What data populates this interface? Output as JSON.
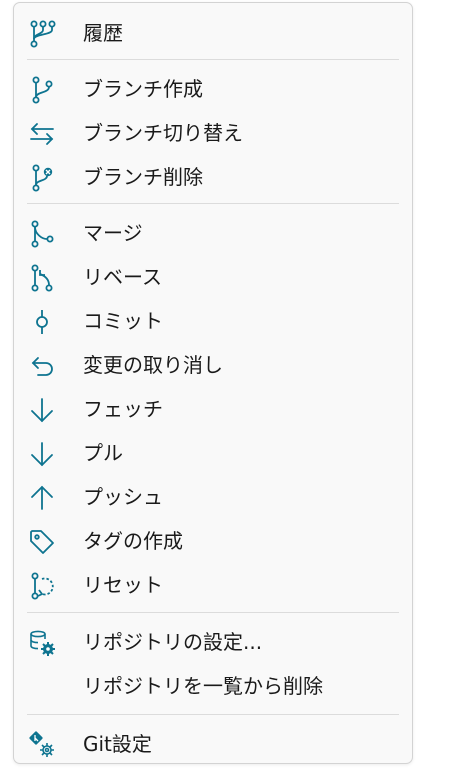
{
  "accent_color": "#0e7490",
  "menu": {
    "items": [
      {
        "label": "履歴",
        "icon": "history-branches-icon"
      },
      {
        "label": "ブランチ作成",
        "icon": "branch-create-icon"
      },
      {
        "label": "ブランチ切り替え",
        "icon": "switch-arrows-icon"
      },
      {
        "label": "ブランチ削除",
        "icon": "branch-delete-icon"
      },
      {
        "label": "マージ",
        "icon": "merge-icon"
      },
      {
        "label": "リベース",
        "icon": "rebase-icon"
      },
      {
        "label": "コミット",
        "icon": "commit-icon"
      },
      {
        "label": "変更の取り消し",
        "icon": "undo-icon"
      },
      {
        "label": "フェッチ",
        "icon": "fetch-arrow-down-icon"
      },
      {
        "label": "プル",
        "icon": "pull-arrow-down-icon"
      },
      {
        "label": "プッシュ",
        "icon": "push-arrow-up-icon"
      },
      {
        "label": "タグの作成",
        "icon": "tag-icon"
      },
      {
        "label": "リセット",
        "icon": "reset-icon"
      },
      {
        "label": "リポジトリの設定...",
        "icon": "repository-settings-icon"
      },
      {
        "label": "リポジトリを一覧から削除",
        "icon": ""
      },
      {
        "label": "Git設定",
        "icon": "git-settings-icon"
      }
    ]
  }
}
